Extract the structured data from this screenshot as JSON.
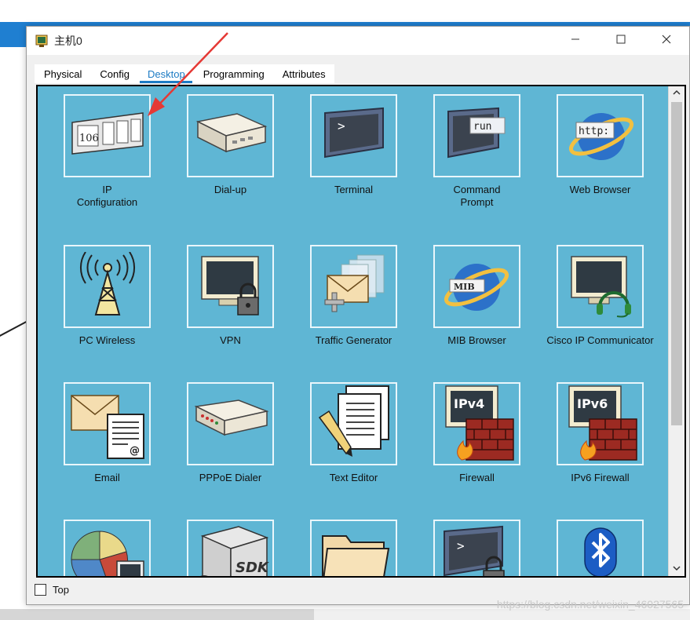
{
  "window": {
    "title": "主机0",
    "controls": [
      "minimize-icon",
      "maximize-icon",
      "close-icon"
    ]
  },
  "tabs": [
    {
      "label": "Physical",
      "active": false
    },
    {
      "label": "Config",
      "active": false
    },
    {
      "label": "Desktop",
      "active": true
    },
    {
      "label": "Programming",
      "active": false
    },
    {
      "label": "Attributes",
      "active": false
    }
  ],
  "apps": [
    {
      "label": "IP\nConfiguration",
      "icon": "ip-config-icon",
      "icon_text": "106"
    },
    {
      "label": "Dial-up",
      "icon": "modem-icon"
    },
    {
      "label": "Terminal",
      "icon": "terminal-icon",
      "icon_text": ">"
    },
    {
      "label": "Command\nPrompt",
      "icon": "command-prompt-icon",
      "icon_text": "run"
    },
    {
      "label": "Web Browser",
      "icon": "web-browser-icon",
      "icon_text": "http:"
    },
    {
      "label": "PC Wireless",
      "icon": "wireless-tower-icon"
    },
    {
      "label": "VPN",
      "icon": "vpn-lock-icon"
    },
    {
      "label": "Traffic Generator",
      "icon": "traffic-generator-icon"
    },
    {
      "label": "MIB Browser",
      "icon": "mib-browser-icon",
      "icon_text": "MIB"
    },
    {
      "label": "Cisco IP Communicator",
      "icon": "ip-communicator-headset-icon"
    },
    {
      "label": "Email",
      "icon": "email-icon",
      "icon_text": "@"
    },
    {
      "label": "PPPoE Dialer",
      "icon": "pppoe-dialer-icon"
    },
    {
      "label": "Text Editor",
      "icon": "text-editor-icon"
    },
    {
      "label": "Firewall",
      "icon": "firewall-icon",
      "icon_text": "IPv4"
    },
    {
      "label": "IPv6 Firewall",
      "icon": "ipv6-firewall-icon",
      "icon_text": "IPv6"
    },
    {
      "label": "",
      "icon": "pie-chart-monitor-icon"
    },
    {
      "label": "",
      "icon": "sdk-box-icon",
      "icon_text": "SDK"
    },
    {
      "label": "",
      "icon": "folder-icon"
    },
    {
      "label": "",
      "icon": "secure-terminal-icon",
      "icon_text": ">"
    },
    {
      "label": "",
      "icon": "bluetooth-icon"
    }
  ],
  "bottom": {
    "top_checkbox_label": "Top",
    "top_checked": false
  },
  "watermark": "https://blog.csdn.net/weixin_46027565",
  "colors": {
    "desktop_bg": "#5fb6d4",
    "tab_active": "#1c7bc4",
    "title_bar_bg": "#1f7fd1",
    "arrow": "#e53935"
  }
}
